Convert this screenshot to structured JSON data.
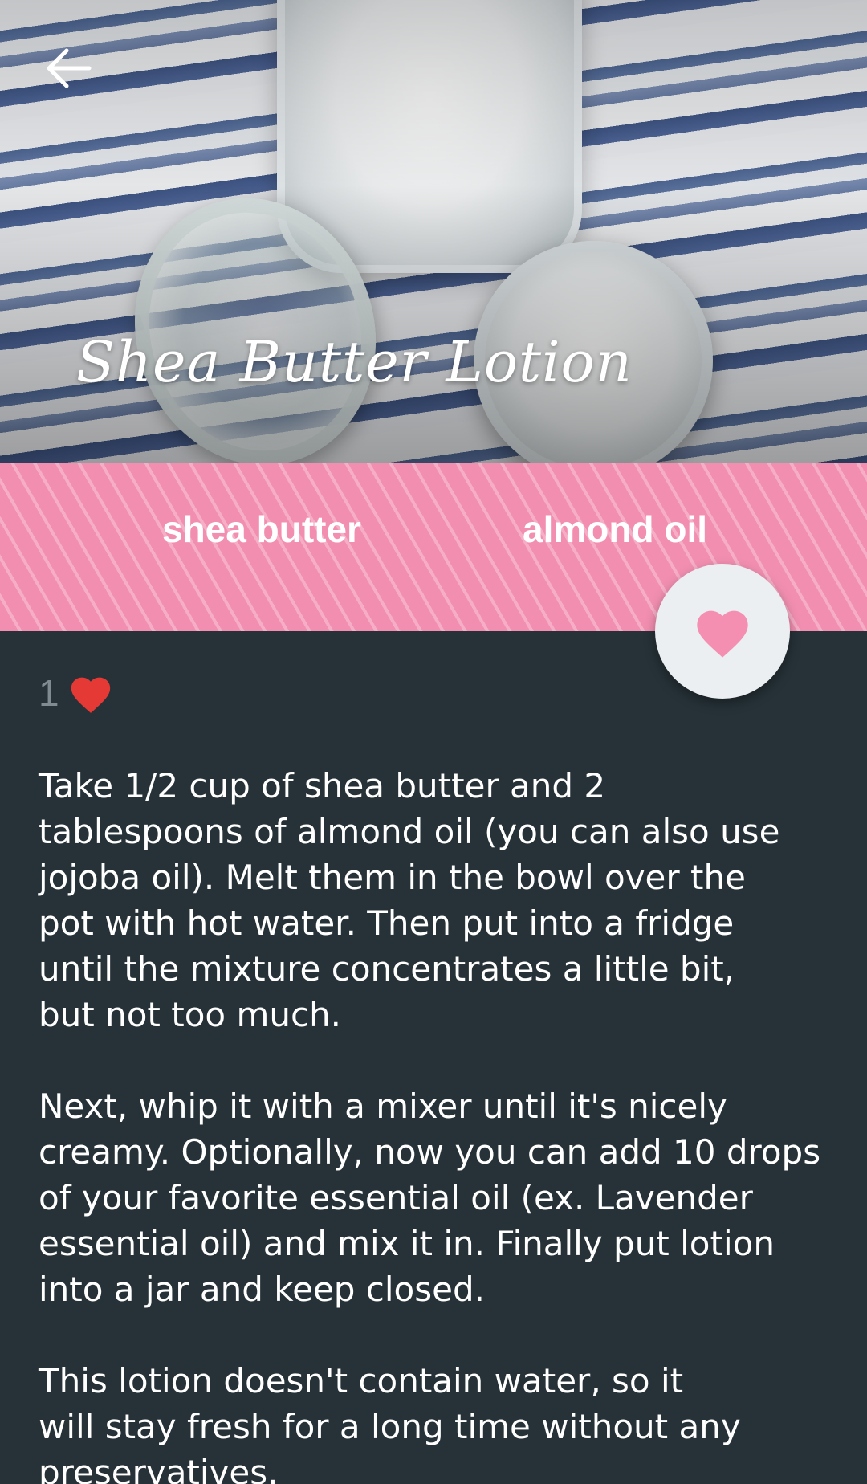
{
  "recipe": {
    "title": "Shea Butter Lotion",
    "ingredients": [
      "shea butter",
      "almond oil"
    ],
    "likes": "1",
    "paragraphs": [
      "Take 1/2 cup of shea butter and 2\ntablespoons of almond oil (you can also use\njojoba oil). Melt them in the bowl over the\npot with hot water.  Then put into a fridge\nuntil the mixture concentrates a little bit,\nbut not too much.",
      "Next, whip it with a mixer until it's nicely\ncreamy. Optionally, now you can add 10 drops\nof your favorite essential oil (ex. Lavender\nessential oil) and mix it in. Finally put lotion\ninto a jar and keep closed.",
      "This lotion doesn't contain water, so it\nwill stay fresh for a long time without any\npreservatives."
    ]
  },
  "icons": {
    "back": "arrow-left-icon",
    "favorite": "heart-icon",
    "likes": "red-heart-icon"
  },
  "colors": {
    "background": "#263238",
    "tag_band": "#f28fb1",
    "fab_heart": "#f48fb1",
    "likes_heart": "#e53935"
  }
}
